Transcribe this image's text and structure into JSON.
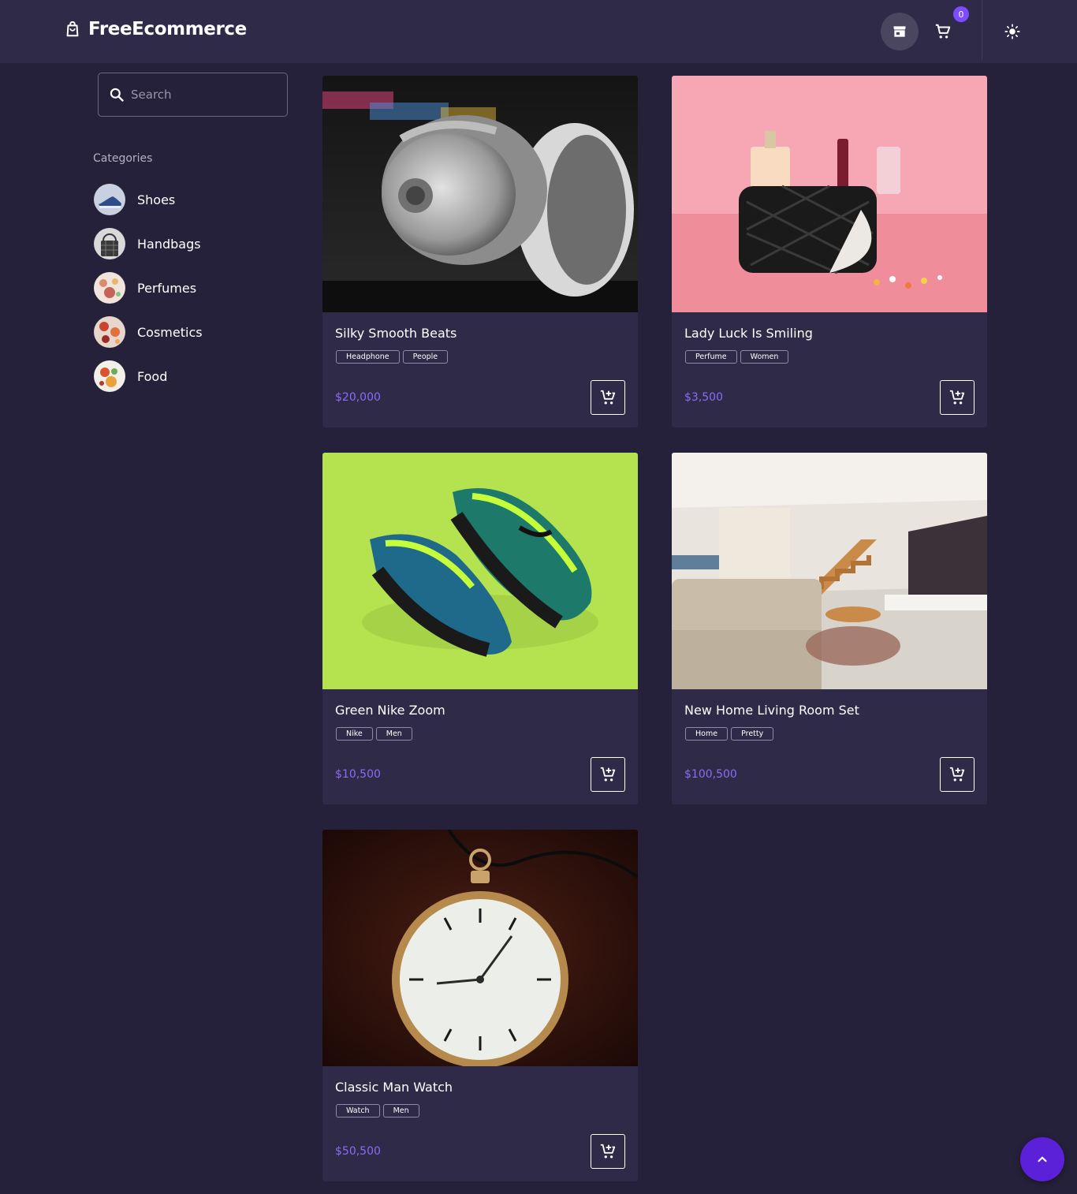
{
  "header": {
    "brand": "FreeEcommerce",
    "cart_count": "0"
  },
  "search": {
    "placeholder": "Search"
  },
  "sidebar": {
    "heading": "Categories",
    "items": [
      {
        "label": "Shoes"
      },
      {
        "label": "Handbags"
      },
      {
        "label": "Perfumes"
      },
      {
        "label": "Cosmetics"
      },
      {
        "label": "Food"
      }
    ]
  },
  "products": [
    {
      "title": "Silky Smooth Beats",
      "tags": [
        "Headphone",
        "People"
      ],
      "price": "$20,000"
    },
    {
      "title": "Lady Luck Is Smiling",
      "tags": [
        "Perfume",
        "Women"
      ],
      "price": "$3,500"
    },
    {
      "title": "Green Nike Zoom",
      "tags": [
        "Nike",
        "Men"
      ],
      "price": "$10,500"
    },
    {
      "title": "New Home Living Room Set",
      "tags": [
        "Home",
        "Pretty"
      ],
      "price": "$100,500"
    },
    {
      "title": "Classic Man Watch",
      "tags": [
        "Watch",
        "Men"
      ],
      "price": "$50,500"
    }
  ],
  "colors": {
    "background": "#26213a",
    "surface": "#2f2a47",
    "accent": "#7c4dff",
    "price": "#8b6cf5"
  },
  "icons": {
    "brand": "shopping-bag-icon",
    "store": "storefront-icon",
    "cart": "cart-icon",
    "theme": "sun-icon",
    "search": "search-icon",
    "add_to_cart": "add-shopping-cart-icon",
    "scroll_top": "chevron-up-icon"
  }
}
